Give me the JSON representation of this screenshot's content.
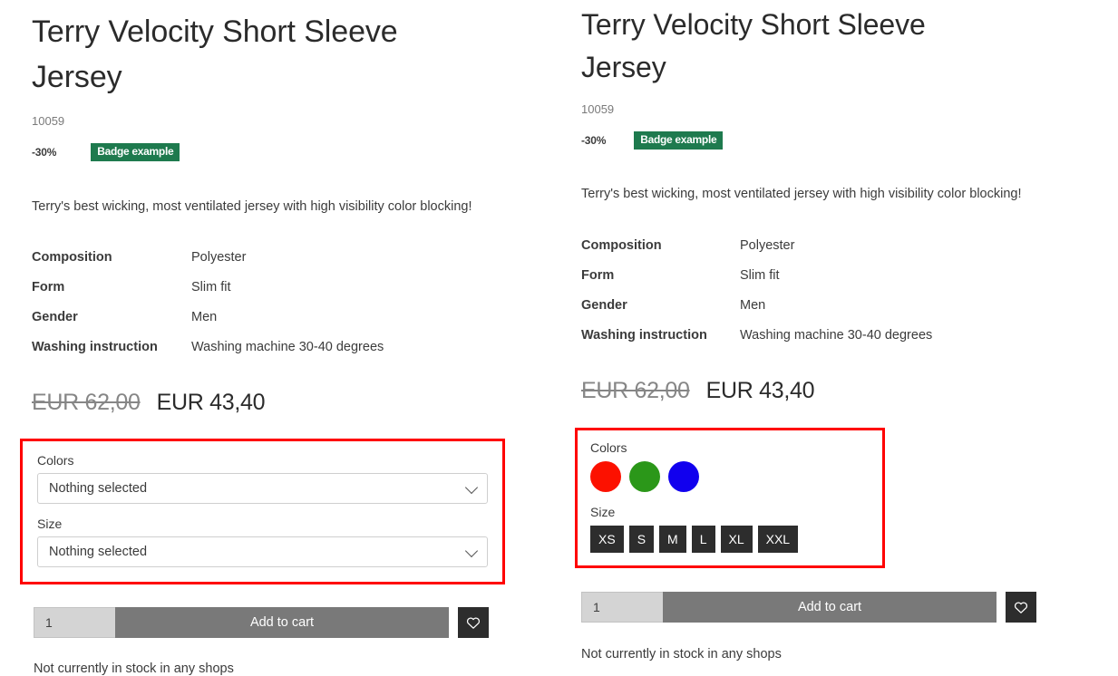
{
  "panels": [
    {
      "id": "left",
      "title": "Terry Velocity Short Sleeve Jersey",
      "sku": "10059",
      "discount": "-30%",
      "promo_badge": "Badge example",
      "description": "Terry's best wicking, most ventilated jersey with high visibility color blocking!",
      "specs": [
        {
          "label": "Composition",
          "value": "Polyester"
        },
        {
          "label": "Form",
          "value": "Slim fit"
        },
        {
          "label": "Gender",
          "value": "Men"
        },
        {
          "label": "Washing instruction",
          "value": "Washing machine 30-40 degrees"
        }
      ],
      "price_old": "EUR 62,00",
      "price_new": "EUR 43,40",
      "options": {
        "style": "dropdowns",
        "colors_label": "Colors",
        "colors_selected": "Nothing selected",
        "size_label": "Size",
        "size_selected": "Nothing selected",
        "border_color": "#ff0000"
      },
      "quantity": "1",
      "add_to_cart_label": "Add to cart",
      "wishlist_icon": "heart-icon",
      "stock_note": "Not currently in stock in any shops"
    },
    {
      "id": "right",
      "title": "Terry Velocity Short Sleeve Jersey",
      "sku": "10059",
      "discount": "-30%",
      "promo_badge": "Badge example",
      "description": "Terry's best wicking, most ventilated jersey with high visibility color blocking!",
      "specs": [
        {
          "label": "Composition",
          "value": "Polyester"
        },
        {
          "label": "Form",
          "value": "Slim fit"
        },
        {
          "label": "Gender",
          "value": "Men"
        },
        {
          "label": "Washing instruction",
          "value": "Washing machine 30-40 degrees"
        }
      ],
      "price_old": "EUR 62,00",
      "price_new": "EUR 43,40",
      "options": {
        "style": "swatches",
        "colors_label": "Colors",
        "swatches": [
          {
            "name": "red",
            "hex": "#fc1100"
          },
          {
            "name": "green",
            "hex": "#2b9719"
          },
          {
            "name": "blue",
            "hex": "#1100ee"
          }
        ],
        "size_label": "Size",
        "sizes": [
          "XS",
          "S",
          "M",
          "L",
          "XL",
          "XXL"
        ],
        "border_color": "#ff0000"
      },
      "quantity": "1",
      "add_to_cart_label": "Add to cart",
      "wishlist_icon": "heart-icon",
      "stock_note": "Not currently in stock in any shops"
    }
  ],
  "theme": {
    "badge_green": "#1e7a4e",
    "button_gray": "#797979",
    "dark_button": "#2d2d2d",
    "highlight_red": "#ff0000"
  }
}
